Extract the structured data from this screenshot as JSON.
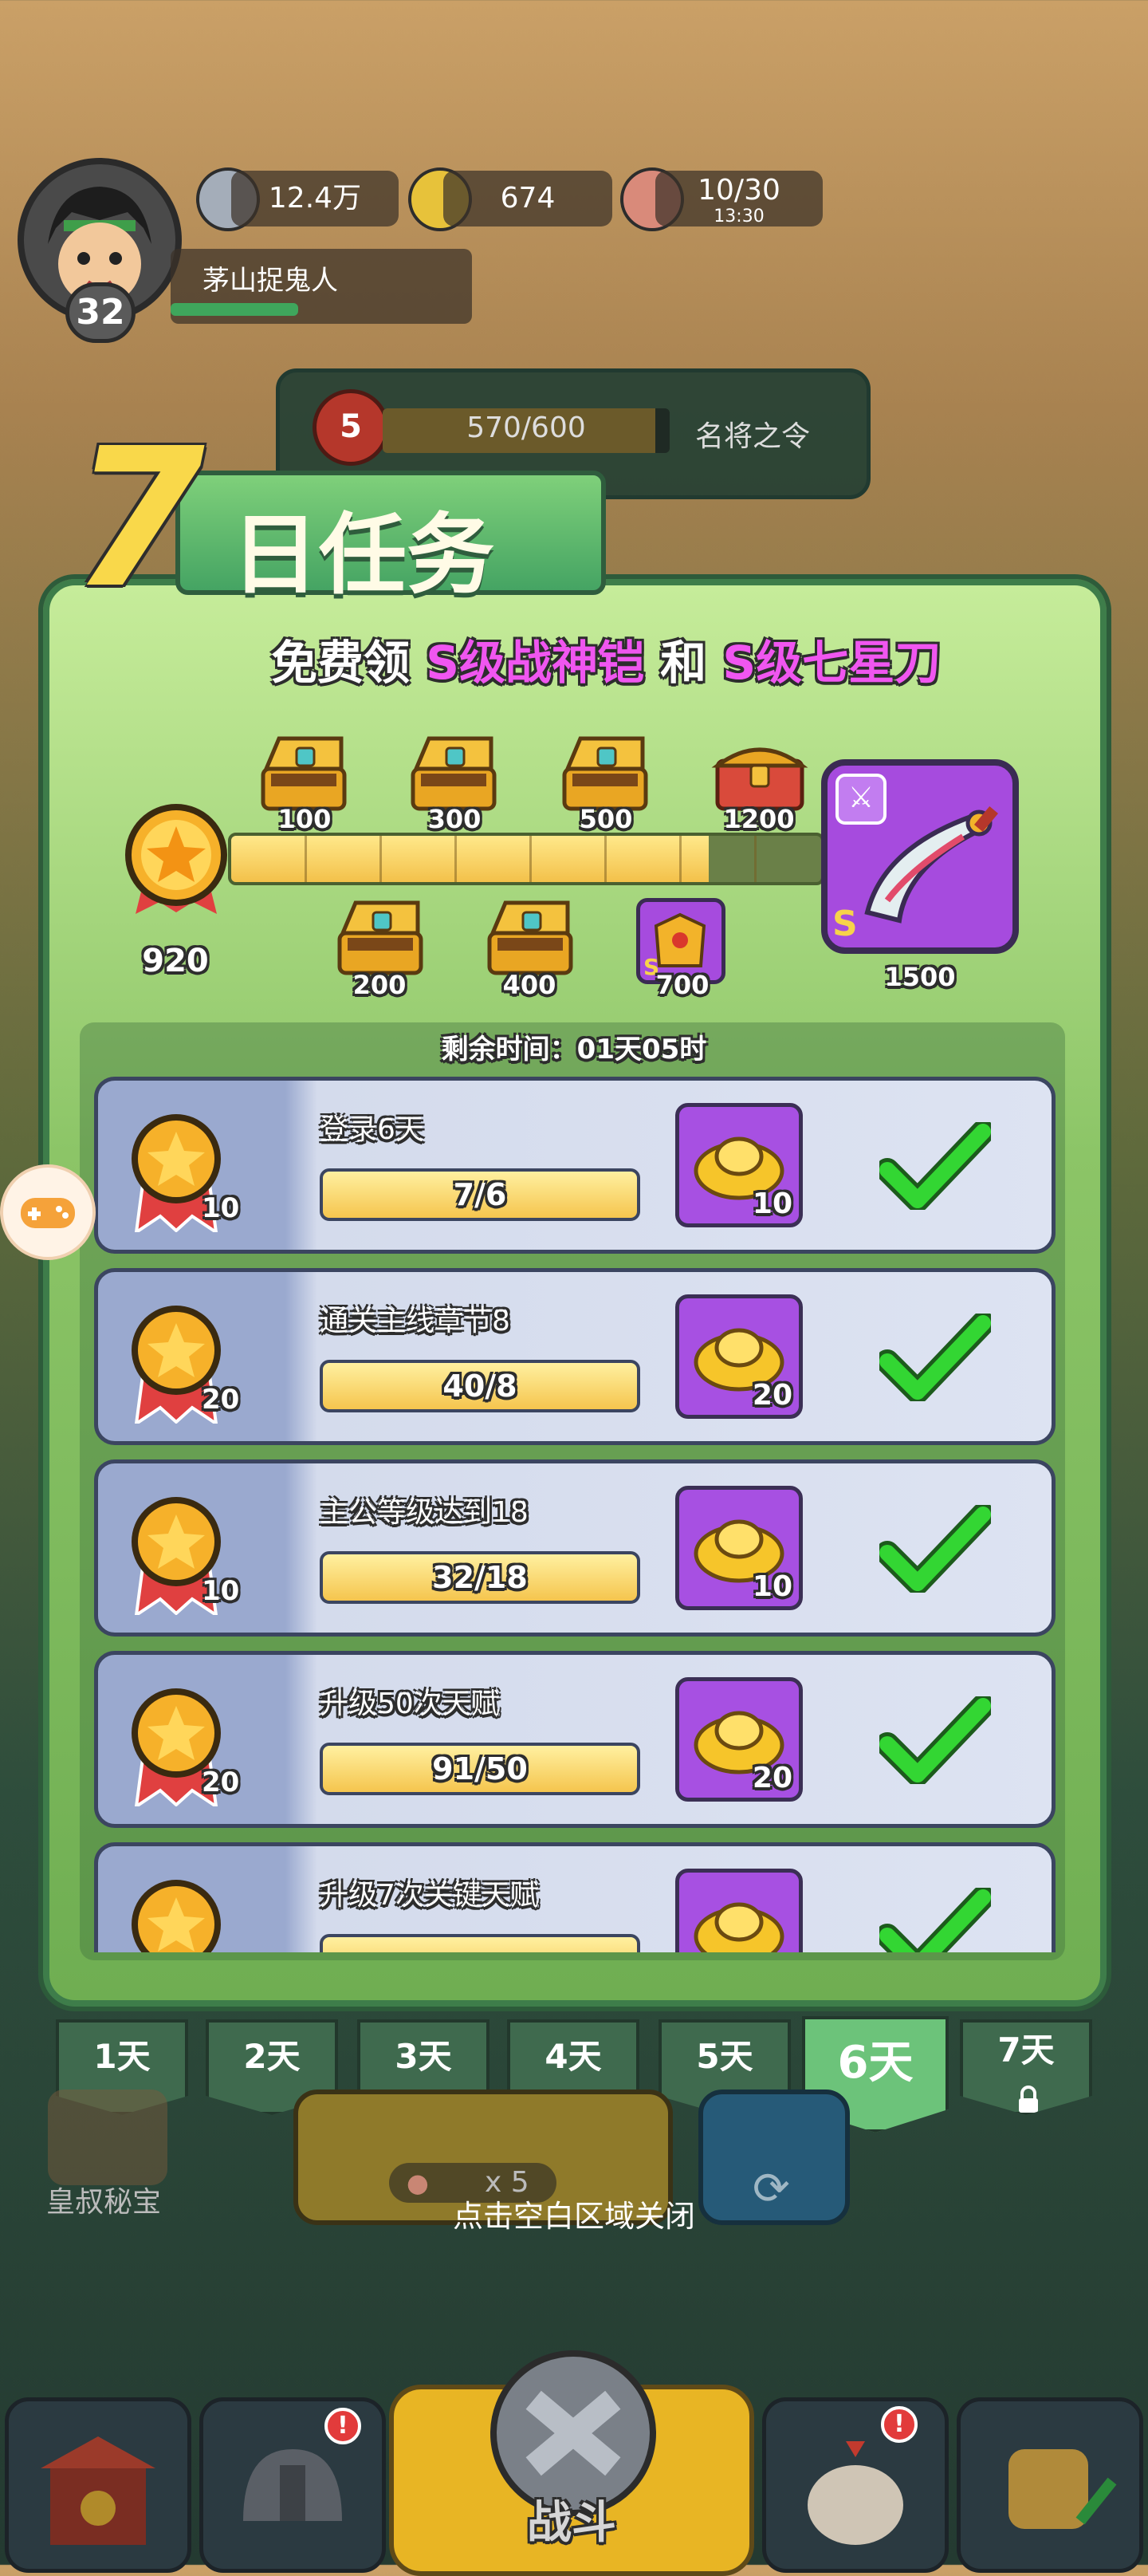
{
  "player": {
    "name": "茅山捉鬼人",
    "level": "32"
  },
  "resources": [
    {
      "icon": "coin-icon",
      "value": "12.4万"
    },
    {
      "icon": "gold-ingot-icon",
      "value": "674"
    },
    {
      "icon": "meat-drumstick-icon",
      "value": "10/30",
      "sub": "13:30"
    }
  ],
  "token_bar": {
    "level": "5",
    "progress": "570/600",
    "label": "名将之令",
    "fraction": 0.95
  },
  "event": {
    "title_num": "7",
    "title_text": "日任务",
    "subtitle_prefix": "免费领",
    "subtitle_item1": "S级战神铠",
    "subtitle_mid": "和",
    "subtitle_item2": "S级七星刀",
    "score": "920",
    "progress_fraction": 0.81,
    "milestones_top": [
      "100",
      "300",
      "500",
      "1200"
    ],
    "milestones_bottom": [
      "200",
      "400",
      "700"
    ],
    "final_reward": {
      "label": "1500",
      "grade": "S"
    },
    "armor_grade": "S",
    "timer": "剩余时间：01天05时"
  },
  "tasks": [
    {
      "name": "登录6天",
      "progress": "7/6",
      "points": "10",
      "reward": "10",
      "done": true
    },
    {
      "name": "通关主线章节8",
      "progress": "40/8",
      "points": "20",
      "reward": "20",
      "done": true
    },
    {
      "name": "主公等级达到18",
      "progress": "32/18",
      "points": "10",
      "reward": "10",
      "done": true
    },
    {
      "name": "升级50次天赋",
      "progress": "91/50",
      "points": "20",
      "reward": "20",
      "done": true
    },
    {
      "name": "升级7次关键天赋",
      "progress": "",
      "points": "",
      "reward": "",
      "done": true
    }
  ],
  "days": [
    "1天",
    "2天",
    "3天",
    "4天",
    "5天",
    "6天",
    "7天"
  ],
  "active_day": "6天",
  "behind": {
    "uncle_treasure": "皇叔秘宝",
    "battle_multiplier": "x 5"
  },
  "close_hint": "点击空白区域关闭",
  "nav": {
    "battle": "战斗"
  },
  "colors": {
    "panel_green": "#8cc567",
    "purple": "#a750e2",
    "gold": "#f5c54e",
    "check_green": "#33d633"
  }
}
